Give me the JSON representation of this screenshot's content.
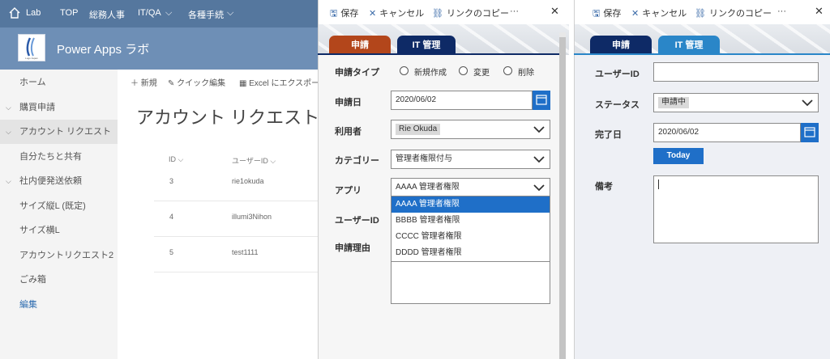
{
  "suite_bar": {
    "items": [
      "Lab",
      "TOP",
      "総務人事",
      "IT/QA",
      "各種手続"
    ],
    "dropdown_items": [
      false,
      false,
      false,
      true,
      true
    ]
  },
  "site": {
    "title": "Power Apps ラボ",
    "logo_text": "Logo Japan"
  },
  "nav": {
    "items": [
      {
        "label": "ホーム",
        "chevron": false
      },
      {
        "label": "購買申請",
        "chevron": true
      },
      {
        "label": "アカウント リクエスト",
        "chevron": true
      },
      {
        "label": "自分たちと共有",
        "chevron": false
      },
      {
        "label": "社内便発送依頼",
        "chevron": true
      },
      {
        "label": "サイズ縦L (既定)",
        "chevron": false
      },
      {
        "label": "サイズ横L",
        "chevron": false
      },
      {
        "label": "アカウントリクエスト2",
        "chevron": false
      },
      {
        "label": "ごみ箱",
        "chevron": false
      },
      {
        "label": "編集",
        "chevron": false
      }
    ],
    "active_index": 2,
    "link_index": 9
  },
  "command_bar": {
    "new": "新規",
    "quick_edit": "クイック編集",
    "export": "Excel にエクスポー"
  },
  "list": {
    "title": "アカウント リクエスト",
    "columns": [
      "ID",
      "ユーザーID"
    ],
    "rows": [
      {
        "id": "3",
        "user": "rie1okuda"
      },
      {
        "id": "4",
        "user": "illumi3Nihon"
      },
      {
        "id": "5",
        "user": "test1111"
      }
    ]
  },
  "toolbar": {
    "save": "保存",
    "cancel": "キャンセル",
    "copy_link": "リンクのコピー",
    "more": "···"
  },
  "mid_form": {
    "tabs": [
      "申請",
      "IT 管理"
    ],
    "request_type_label": "申請タイプ",
    "request_type_options": [
      "新規作成",
      "変更",
      "削除"
    ],
    "date_label": "申請日",
    "date_value": "2020/06/02",
    "user_label": "利用者",
    "user_value": "Rie Okuda",
    "category_label": "カテゴリー",
    "category_value": "管理者権限付与",
    "app_label": "アプリ",
    "app_value": "AAAA 管理者権限",
    "app_options": [
      "AAAA 管理者権限",
      "BBBB 管理者権限",
      "CCCC 管理者権限",
      "DDDD 管理者権限"
    ],
    "app_selected_index": 0,
    "userid_label": "ユーザーID",
    "reason_label": "申請理由"
  },
  "right_form": {
    "tabs": [
      "申請",
      "IT 管理"
    ],
    "userid_label": "ユーザーID",
    "userid_value": "",
    "status_label": "ステータス",
    "status_value": "申請中",
    "done_label": "完了日",
    "done_value": "2020/06/02",
    "today_button": "Today",
    "notes_label": "備考"
  },
  "colors": {
    "suite_bar": "#55779e",
    "site_header": "#6e8fb6",
    "tab_orange": "#b3461b",
    "tab_navy": "#0e2a66",
    "tab_blue": "#2a86c8",
    "accent": "#1f6fc8"
  }
}
